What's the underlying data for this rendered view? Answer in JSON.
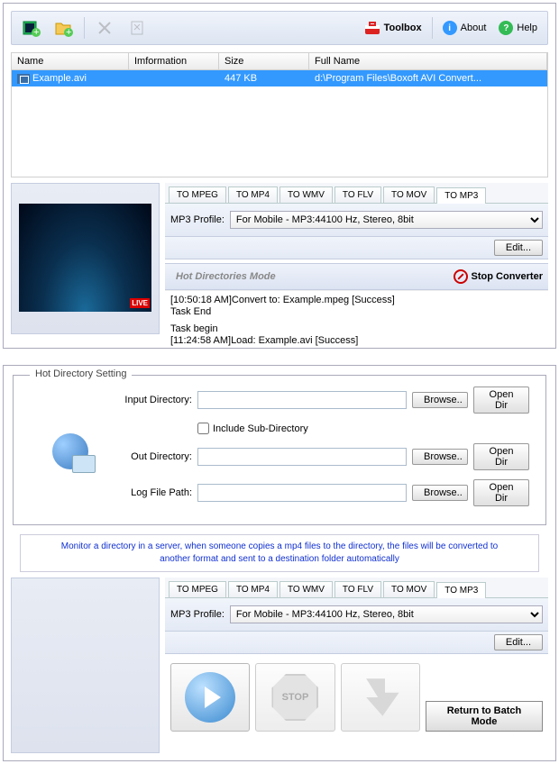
{
  "toolbar": {
    "toolbox": "Toolbox",
    "about": "About",
    "help": "Help"
  },
  "grid": {
    "headers": {
      "name": "Name",
      "info": "Imformation",
      "size": "Size",
      "full": "Full Name"
    },
    "rows": [
      {
        "name": "Example.avi",
        "info": "",
        "size": "447 KB",
        "full": "d:\\Program Files\\Boxoft AVI Convert..."
      }
    ]
  },
  "tabs": {
    "mpeg": "TO MPEG",
    "mp4": "TO MP4",
    "wmv": "TO WMV",
    "flv": "TO FLV",
    "mov": "TO MOV",
    "mp3": "TO MP3"
  },
  "profile": {
    "label": "MP3 Profile:",
    "value": "For Mobile - MP3:44100 Hz, Stereo, 8bit",
    "edit": "Edit..."
  },
  "hotbar": {
    "label": "Hot Directories Mode",
    "stop": "Stop Converter"
  },
  "log": {
    "l1": "[10:50:18 AM]Convert to: Example.mpeg [Success]",
    "l2": "Task End",
    "l3": "Task begin",
    "l4": "[11:24:58 AM]Load: Example.avi [Success]"
  },
  "preview": {
    "live": "LIVE"
  },
  "hds": {
    "title": "Hot Directory Setting",
    "input_label": "Input Directory:",
    "include": "Include Sub-Directory",
    "out_label": "Out Directory:",
    "log_label": "Log File Path:",
    "browse": "Browse..",
    "open": "Open Dir",
    "hint": "Monitor a directory in a server, when someone copies a mp4 files to the directory, the files will be converted to another format and sent to a destination folder automatically"
  },
  "big": {
    "stop": "STOP",
    "return": "Return to Batch Mode"
  }
}
